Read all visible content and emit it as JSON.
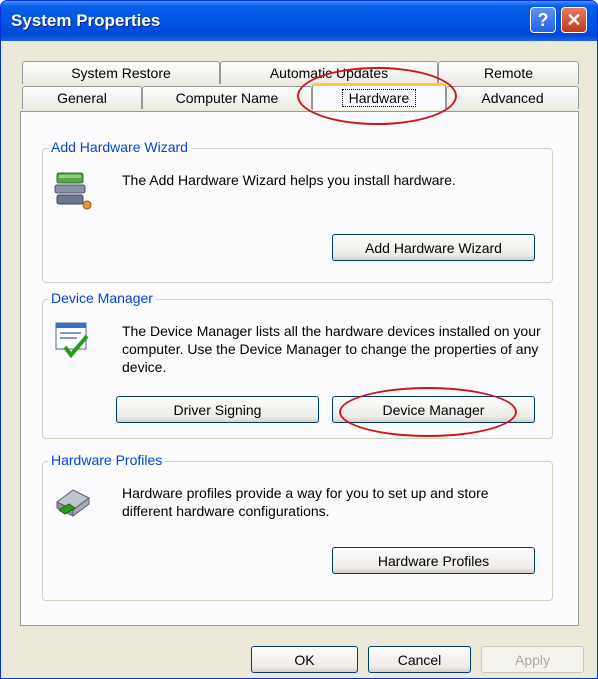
{
  "window": {
    "title": "System Properties"
  },
  "titlebar": {
    "help_glyph": "?",
    "close_glyph": "✕"
  },
  "tabs_row1": [
    {
      "label": "System Restore"
    },
    {
      "label": "Automatic Updates"
    },
    {
      "label": "Remote"
    }
  ],
  "tabs_row2": [
    {
      "label": "General"
    },
    {
      "label": "Computer Name"
    },
    {
      "label": "Hardware",
      "active": true
    },
    {
      "label": "Advanced"
    }
  ],
  "add_hardware": {
    "legend": "Add Hardware Wizard",
    "text": "The Add Hardware Wizard helps you install hardware.",
    "button": "Add Hardware Wizard"
  },
  "device_manager": {
    "legend": "Device Manager",
    "text": "The Device Manager lists all the hardware devices installed on your computer. Use the Device Manager to change the properties of any device.",
    "driver_signing_button": "Driver Signing",
    "device_manager_button": "Device Manager"
  },
  "hardware_profiles": {
    "legend": "Hardware Profiles",
    "text": "Hardware profiles provide a way for you to set up and store different hardware configurations.",
    "button": "Hardware Profiles"
  },
  "footer": {
    "ok": "OK",
    "cancel": "Cancel",
    "apply": "Apply"
  },
  "colors": {
    "titlebar": "#0055e5",
    "legend": "#0046d5",
    "annotation": "#d0151c",
    "active_tab_accent": "#ffc83c"
  }
}
